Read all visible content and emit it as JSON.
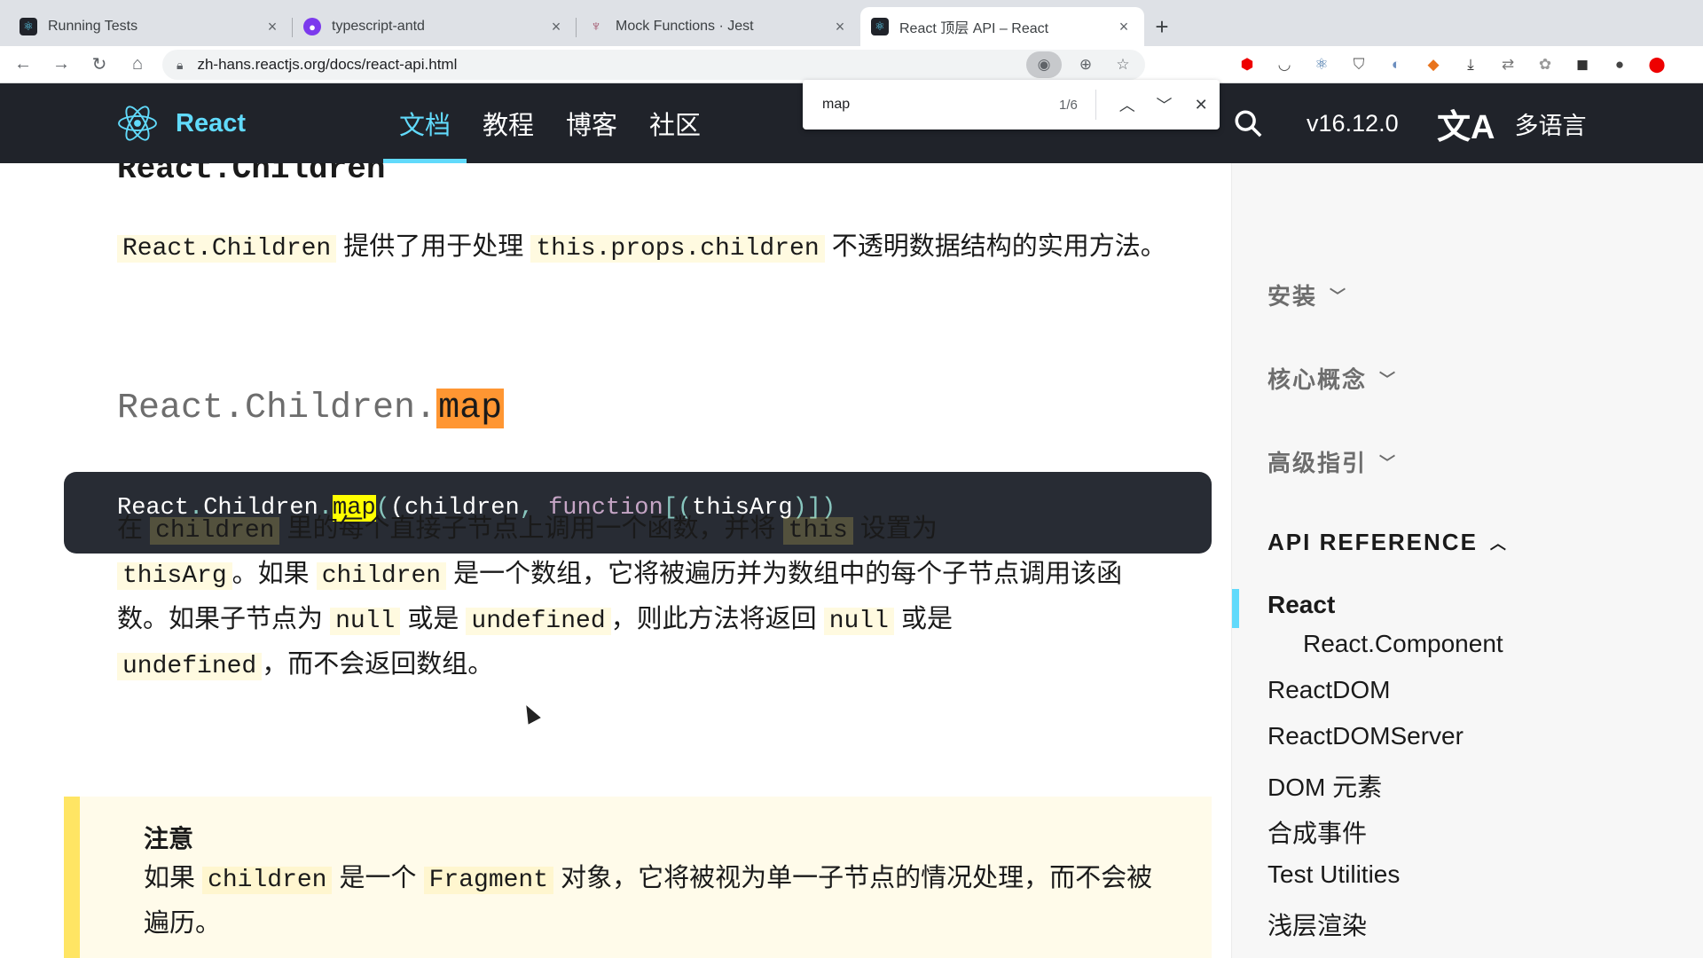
{
  "browser": {
    "tabs": [
      {
        "title": "Running Tests",
        "icon": "react-logo-icon"
      },
      {
        "title": "typescript-antd",
        "icon": "purple-circle-icon"
      },
      {
        "title": "Mock Functions · Jest",
        "icon": "jest-icon"
      },
      {
        "title": "React 顶层 API – React",
        "icon": "react-logo-icon"
      }
    ],
    "url": "zh-hans.reactjs.org/docs/react-api.html"
  },
  "find": {
    "query": "map",
    "count": "1/6"
  },
  "header": {
    "brand": "React",
    "nav": [
      "文档",
      "教程",
      "博客",
      "社区"
    ],
    "version": "v16.12.0",
    "lang_label": "多语言",
    "lang_glyph": "文A"
  },
  "content": {
    "section_title": "React.Children",
    "intro": {
      "code1": "React.Children",
      "t1": " 提供了用于处理 ",
      "code2": "this.props.children",
      "t2": " 不透明数据结构的实用方法。"
    },
    "subtitle_prefix": "React.Children.",
    "subtitle_highlight": "map",
    "codeblock": {
      "a": "React",
      "b": "Children",
      "hl": "map",
      "c": "(children",
      "d": "function",
      "e": "thisArg"
    },
    "desc": {
      "s1": "在 ",
      "c1": "children",
      "s2": " 里的每个直接子节点上调用一个函数，并将 ",
      "c2": "this",
      "s3": " 设置为",
      "c3": "thisArg",
      "s4": "。如果 ",
      "c4": "children",
      "s5": " 是一个数组，它将被遍历并为数组中的每个子节点调用该函数。如果子节点为 ",
      "c5": "null",
      "s6": " 或是 ",
      "c6": "undefined",
      "s7": "，则此方法将返回 ",
      "c7": "null",
      "s8": " 或是 ",
      "c8": "undefined",
      "s9": "，而不会返回数组。"
    },
    "note": {
      "title": "注意",
      "t1": "如果 ",
      "c1": "children",
      "t2": " 是一个 ",
      "c2": "Fragment",
      "t3": " 对象，它将被视为单一子节点的情况处理，而不会被遍历。"
    }
  },
  "sidebar": {
    "sections": [
      "安装",
      "核心概念",
      "高级指引",
      "API REFERENCE"
    ],
    "items": [
      "React",
      "React.Component",
      "ReactDOM",
      "ReactDOMServer",
      "DOM 元素",
      "合成事件",
      "Test Utilities",
      "浅层渲染"
    ]
  },
  "colors": {
    "react_blue": "#61dafb",
    "header_bg": "#20232a",
    "code_bg": "#282c34",
    "note_border": "#ffe564"
  }
}
